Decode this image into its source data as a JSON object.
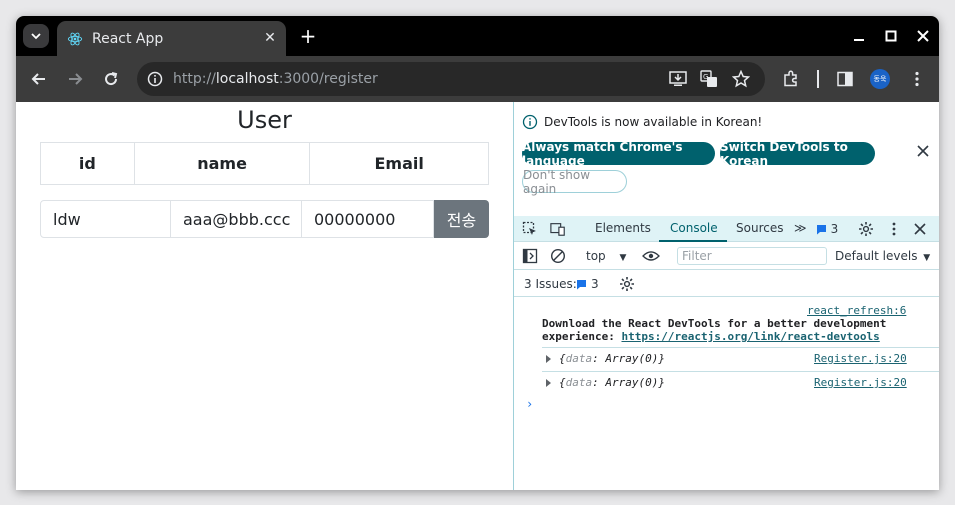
{
  "browser": {
    "tab_title": "React App",
    "tab_close": "✕",
    "new_tab": "+",
    "url_prefix": "http://",
    "url_host": "localhost",
    "url_path": ":3000/register",
    "profile_initials": "동욱"
  },
  "page": {
    "title": "User",
    "table_headers": [
      "id",
      "name",
      "Email"
    ],
    "inputs": {
      "id_value": "ldw",
      "name_value": "aaa@bbb.ccc",
      "email_value": "00000000"
    },
    "submit_label": "전송"
  },
  "devtools": {
    "info_message": "DevTools is now available in Korean!",
    "btn_always_match": "Always match Chrome's language",
    "btn_switch": "Switch DevTools to Korean",
    "btn_dont_show": "Don't show again",
    "tabs": {
      "elements": "Elements",
      "console": "Console",
      "sources": "Sources",
      "more": "≫"
    },
    "issue_count_badge": "3",
    "context_selector": "top",
    "filter_placeholder": "Filter",
    "default_levels": "Default levels",
    "issues_label": "3 Issues:",
    "issues_count": "3",
    "logs": {
      "source1": "react_refresh:6",
      "message_line1": "Download the React DevTools for a better development",
      "message_line2_prefix": "experience: ",
      "message_link": "https://reactjs.org/link/react-devtools",
      "obj1_key": "data",
      "obj1_value": "Array(0)",
      "obj1_source": "Register.js:20",
      "obj2_key": "data",
      "obj2_value": "Array(0)",
      "obj2_source": "Register.js:20"
    }
  }
}
